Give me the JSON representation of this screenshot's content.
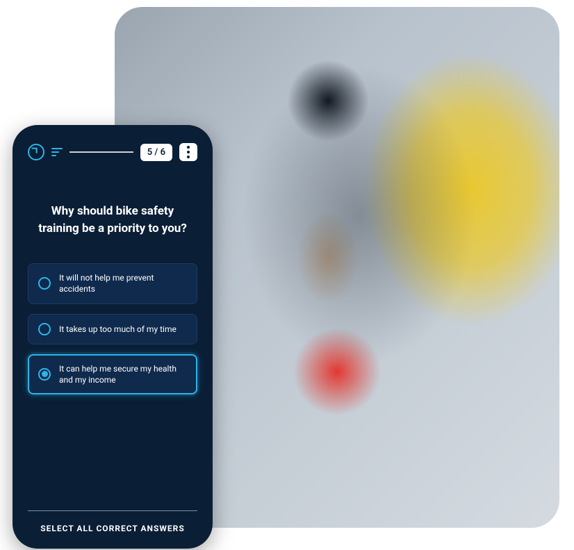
{
  "header": {
    "progress_counter": "5 / 6"
  },
  "quiz": {
    "question": "Why should bike safety training be a priority to you?",
    "options": [
      {
        "label": "It will not help me prevent accidents",
        "selected": false
      },
      {
        "label": "It takes up too much of my time",
        "selected": false
      },
      {
        "label": "It can help me secure my health and my income",
        "selected": true
      }
    ],
    "footer_instruction": "SELECT ALL CORRECT ANSWERS"
  }
}
